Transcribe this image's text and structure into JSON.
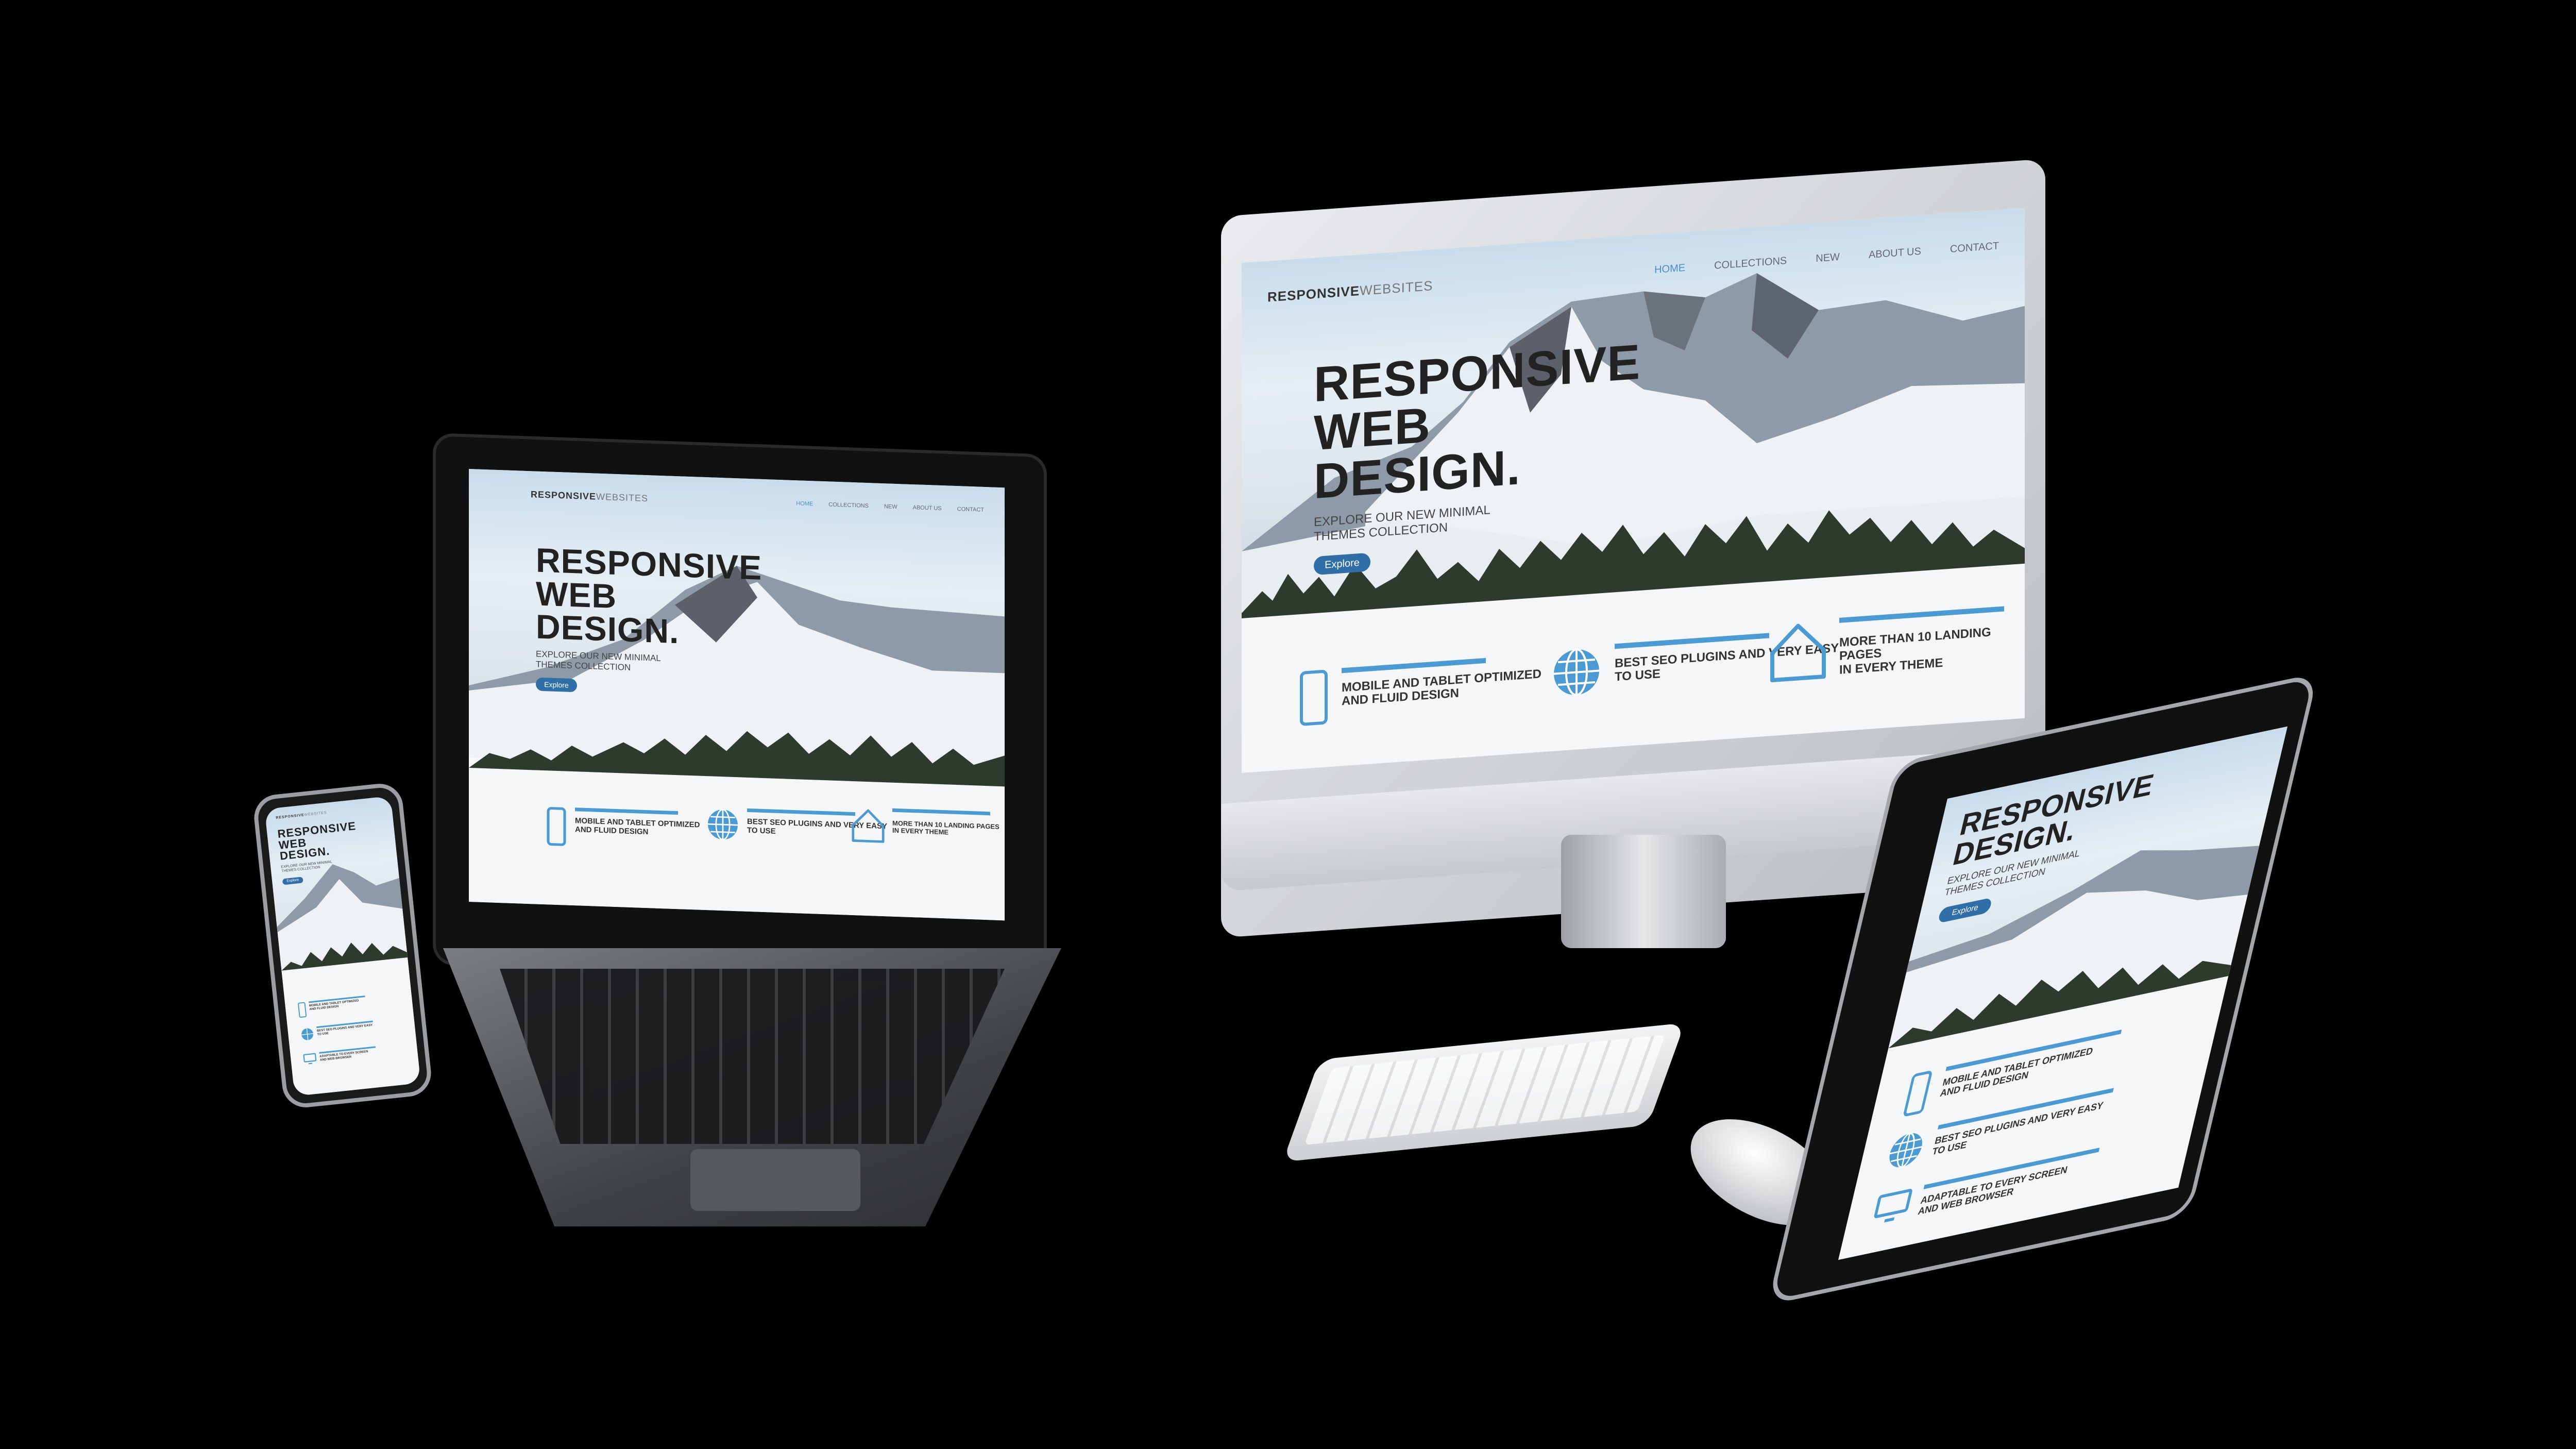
{
  "site": {
    "logo_bold": "RESPONSIVE",
    "logo_thin": "WEBSITES",
    "nav": [
      "HOME",
      "COLLECTIONS",
      "NEW",
      "ABOUT US",
      "CONTACT"
    ],
    "hero_line1": "RESPONSIVE",
    "hero_line2": "WEB",
    "hero_line3": "DESIGN.",
    "hero_subtitle_1": "EXPLORE OUR NEW MINIMAL",
    "hero_subtitle_2": "THEMES COLLECTION",
    "explore_button": "Explore",
    "features": [
      {
        "icon": "phone-icon",
        "line1": "MOBILE AND TABLET OPTIMIZED",
        "line2": "AND FLUID DESIGN"
      },
      {
        "icon": "globe-icon",
        "line1": "BEST SEO PLUGINS AND VERY EASY",
        "line2": "TO USE"
      },
      {
        "icon": "house-icon",
        "line1": "MORE THAN 10 LANDING PAGES",
        "line2": "IN EVERY THEME"
      }
    ],
    "tablet_feature_3": {
      "icon": "monitor-icon",
      "line1": "ADAPTABLE TO EVERY SCREEN",
      "line2": "AND WEB BROWSER"
    }
  },
  "colors": {
    "accent": "#4b9ad4",
    "button": "#2f6ea6",
    "background": "#000000",
    "device_silver": "#c9ccd0"
  }
}
